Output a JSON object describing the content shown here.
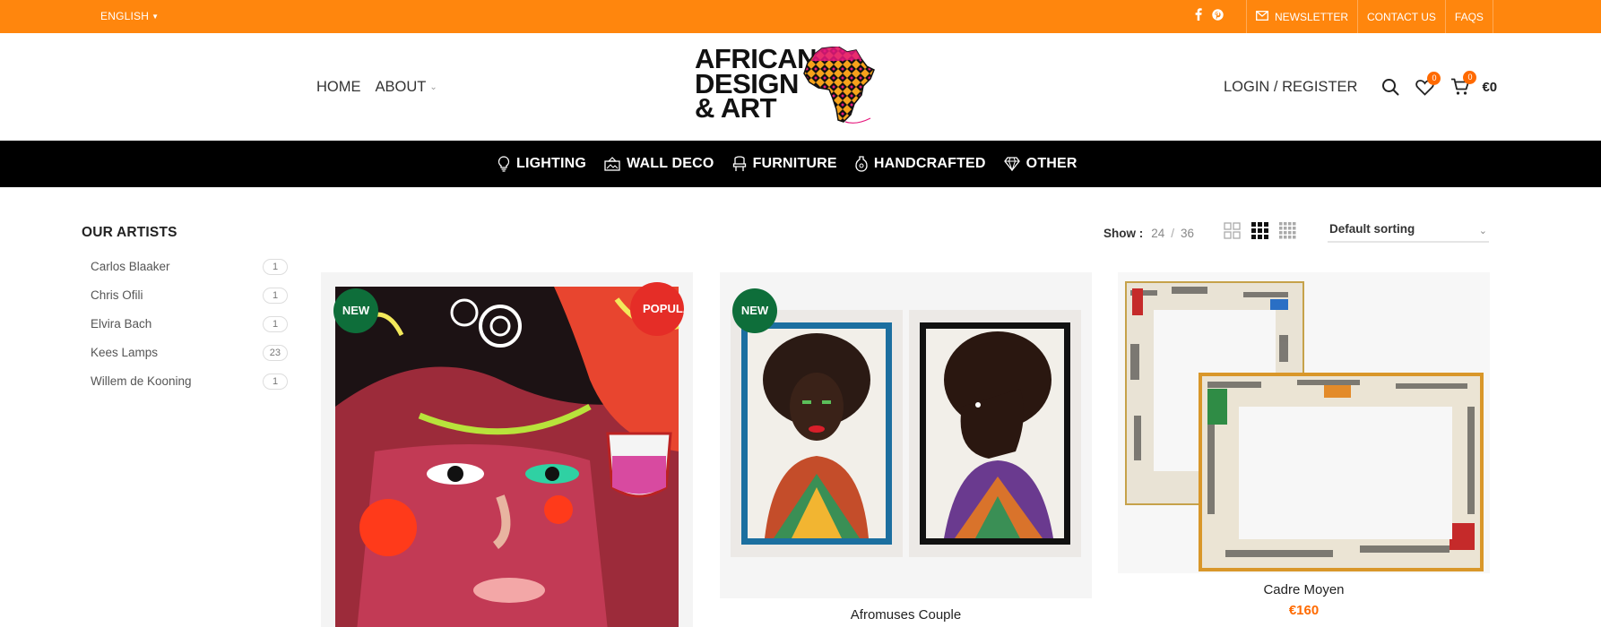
{
  "topbar": {
    "language": "ENGLISH",
    "social": [
      "facebook-icon",
      "pinterest-icon"
    ],
    "links": [
      {
        "label": "NEWSLETTER",
        "icon": "envelope-icon"
      },
      {
        "label": "CONTACT US"
      },
      {
        "label": "FAQS"
      }
    ],
    "bg_color": "#ff860d"
  },
  "header": {
    "nav_left": [
      {
        "label": "HOME"
      },
      {
        "label": "ABOUT"
      }
    ],
    "logo_lines": [
      "AFRICAN",
      "DESIGN",
      "& ART"
    ],
    "login_label": "LOGIN / REGISTER",
    "wishlist_count": "0",
    "cart_count": "0",
    "cart_total": "€0"
  },
  "categories": [
    {
      "label": "LIGHTING",
      "icon": "lightbulb-icon"
    },
    {
      "label": "WALL DECO",
      "icon": "picture-frame-icon"
    },
    {
      "label": "FURNITURE",
      "icon": "chair-icon"
    },
    {
      "label": "HANDCRAFTED",
      "icon": "vase-icon"
    },
    {
      "label": "OTHER",
      "icon": "diamond-icon"
    }
  ],
  "sidebar": {
    "title": "OUR ARTISTS",
    "items": [
      {
        "label": "Carlos Blaaker",
        "count": "1"
      },
      {
        "label": "Chris Ofili",
        "count": "1"
      },
      {
        "label": "Elvira Bach",
        "count": "1"
      },
      {
        "label": "Kees Lamps",
        "count": "23"
      },
      {
        "label": "Willem de Kooning",
        "count": "1"
      }
    ]
  },
  "toolbar": {
    "show_label": "Show :",
    "per_page": [
      "24",
      "36"
    ],
    "separator": "/",
    "sort_selected": "Default sorting"
  },
  "products": [
    {
      "name": "",
      "price": "",
      "badges": [
        "NEW",
        "POPULAR"
      ]
    },
    {
      "name": "Afromuses Couple",
      "price": "",
      "badges": [
        "NEW"
      ]
    },
    {
      "name": "Cadre Moyen",
      "price": "€160",
      "badges": []
    }
  ],
  "colors": {
    "accent": "#ff860d",
    "price": "#ff6a00",
    "badge_new": "#0e6e3a",
    "badge_popular": "#e52d27"
  }
}
